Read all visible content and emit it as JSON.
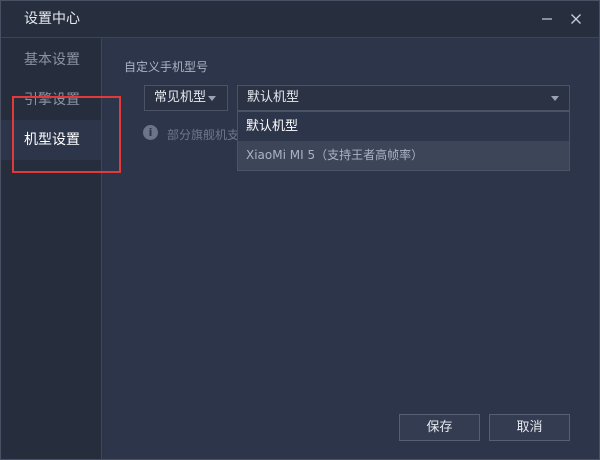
{
  "window": {
    "title": "设置中心"
  },
  "sidebar": {
    "items": [
      {
        "label": "基本设置"
      },
      {
        "label": "引擎设置"
      },
      {
        "label": "机型设置",
        "active": true
      }
    ]
  },
  "main": {
    "section_label": "自定义手机型号",
    "type_select": {
      "value": "常见机型"
    },
    "model_select": {
      "value": "默认机型",
      "options": [
        {
          "label": "默认机型"
        },
        {
          "label": "XiaoMi MI 5（支持王者高帧率）"
        }
      ]
    },
    "hint_icon": "info-icon",
    "hint_text": "部分旗舰机支"
  },
  "footer": {
    "save_label": "保存",
    "cancel_label": "取消"
  },
  "colors": {
    "background": "#2c3549",
    "sidebar": "#262d3c",
    "highlight": "#e23a3a"
  }
}
